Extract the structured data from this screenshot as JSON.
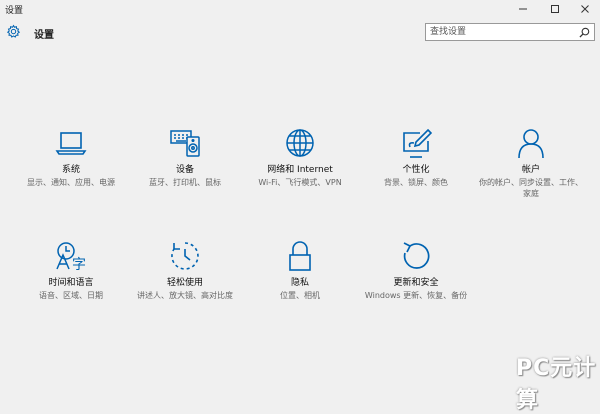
{
  "window": {
    "title": "设置",
    "minimize_glyph": "minimize-icon",
    "maximize_glyph": "maximize-icon",
    "close_glyph": "close-icon"
  },
  "header": {
    "icon": "gear-icon",
    "title": "设置"
  },
  "search": {
    "placeholder": "查找设置",
    "icon": "search-icon"
  },
  "colors": {
    "accent": "#0063b1",
    "background": "#f0f0f0",
    "label": "#111111",
    "description": "#666666"
  },
  "tiles": [
    {
      "label": "系统",
      "desc": "显示、通知、应用、电源",
      "icon": "laptop-icon"
    },
    {
      "label": "设备",
      "desc": "蓝牙、打印机、鼠标",
      "icon": "devices-icon"
    },
    {
      "label": "网络和 Internet",
      "desc": "Wi-Fi、飞行模式、VPN",
      "icon": "globe-icon"
    },
    {
      "label": "个性化",
      "desc": "背景、锁屏、颜色",
      "icon": "personalize-icon"
    },
    {
      "label": "帐户",
      "desc": "你的帐户、同步设置、工作、家庭",
      "icon": "person-icon"
    },
    {
      "label": "时间和语言",
      "desc": "语音、区域、日期",
      "icon": "time-language-icon"
    },
    {
      "label": "轻松使用",
      "desc": "讲述人、放大镜、高对比度",
      "icon": "ease-of-access-icon"
    },
    {
      "label": "隐私",
      "desc": "位置、相机",
      "icon": "lock-icon"
    },
    {
      "label": "更新和安全",
      "desc": "Windows 更新、恢复、备份",
      "icon": "update-icon"
    }
  ],
  "watermark": "PC元计算"
}
